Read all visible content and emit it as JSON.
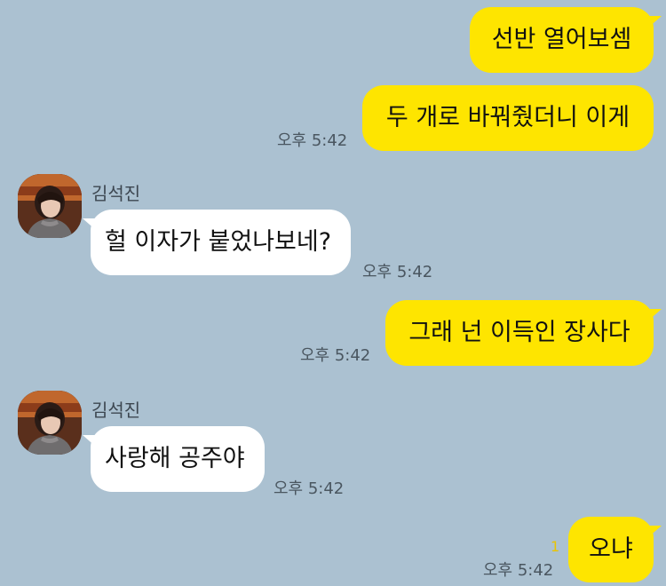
{
  "colors": {
    "background": "#abc1d1",
    "my_bubble": "#fee500",
    "their_bubble": "#ffffff",
    "unread_count": "#e9c400"
  },
  "messages": [
    {
      "from": "me",
      "text": "선반 열어보셈"
    },
    {
      "from": "me",
      "text": "두 개로 바꿔줬더니 이게",
      "time": "오후 5:42"
    },
    {
      "from": "contact",
      "sender": "김석진",
      "avatar_icon": "profile-photo",
      "text": "헐 이자가 붙었나보네?",
      "time": "오후 5:42"
    },
    {
      "from": "me",
      "text": "그래 넌 이득인 장사다",
      "time": "오후 5:42"
    },
    {
      "from": "contact",
      "sender": "김석진",
      "avatar_icon": "profile-photo",
      "text": "사랑해 공주야",
      "time": "오후 5:42"
    },
    {
      "from": "me",
      "text": "오냐",
      "time": "오후 5:42",
      "unread": "1"
    }
  ]
}
